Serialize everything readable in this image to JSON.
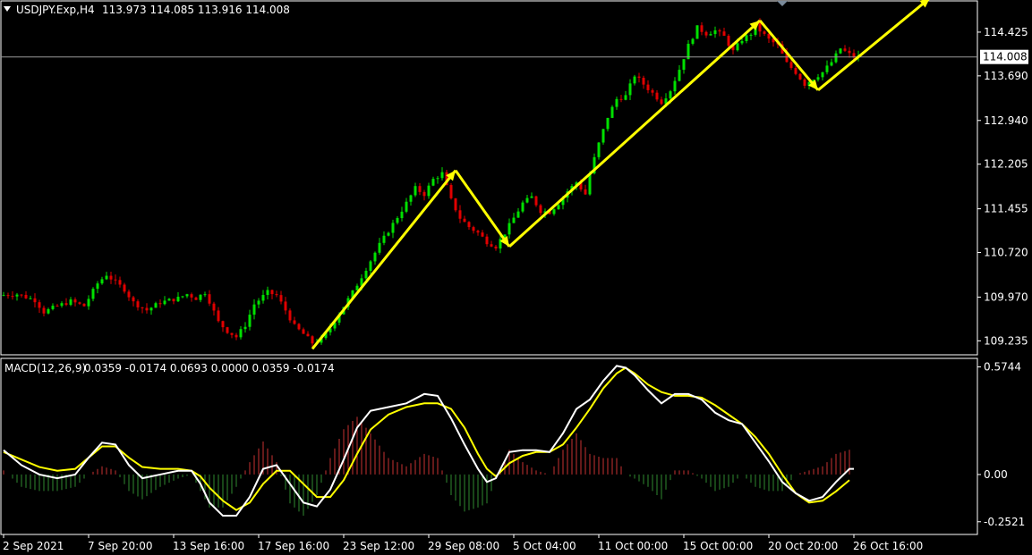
{
  "window": {
    "title": "USDJPY.Exp,H4",
    "ohlc": "113.973 114.085 113.916 114.008"
  },
  "macd": {
    "title": "MACD(12,26,9)",
    "values": "0.0359 -0.0174 0.0693 0.0000 0.0359 -0.0174"
  },
  "colors": {
    "background": "#000000",
    "bull": "#00e000",
    "bear": "#e00000",
    "arrow": "#ffff00",
    "macd_main": "#ffffff",
    "macd_signal": "#ffff00",
    "hist_pos": "#c83232",
    "hist_neg": "#2f8a2f",
    "price_line": "#9a9a9a"
  },
  "chart_data": [
    {
      "type": "candlestick",
      "symbol": "USDJPY.Exp",
      "timeframe": "H4",
      "ylim": [
        109.0,
        114.95
      ],
      "y_ticks": [
        "114.425",
        "113.690",
        "112.940",
        "112.205",
        "111.455",
        "110.720",
        "109.970",
        "109.235"
      ],
      "current_price": "114.008",
      "x_tick_labels": [
        "2 Sep 2021",
        "7 Sep 20:00",
        "13 Sep 16:00",
        "17 Sep 16:00",
        "23 Sep 12:00",
        "29 Sep 08:00",
        "5 Oct 04:00",
        "11 Oct 00:00",
        "15 Oct 00:00",
        "20 Oct 20:00",
        "26 Oct 16:00"
      ],
      "price_path": [
        [
          0,
          110.0
        ],
        [
          4,
          110.02
        ],
        [
          8,
          109.92
        ],
        [
          10,
          109.72
        ],
        [
          13,
          109.82
        ],
        [
          16,
          109.9
        ],
        [
          19,
          109.82
        ],
        [
          22,
          110.2
        ],
        [
          24,
          110.35
        ],
        [
          26,
          110.22
        ],
        [
          28,
          110.1
        ],
        [
          30,
          109.88
        ],
        [
          33,
          109.75
        ],
        [
          36,
          109.88
        ],
        [
          40,
          109.95
        ],
        [
          42,
          110.02
        ],
        [
          44,
          109.95
        ],
        [
          46,
          110.05
        ],
        [
          47,
          109.9
        ],
        [
          49,
          109.55
        ],
        [
          51,
          109.4
        ],
        [
          53,
          109.3
        ],
        [
          55,
          109.5
        ],
        [
          57,
          109.85
        ],
        [
          60,
          110.05
        ],
        [
          62,
          110.0
        ],
        [
          64,
          109.75
        ],
        [
          66,
          109.48
        ],
        [
          68,
          109.35
        ],
        [
          70,
          109.2
        ],
        [
          72,
          109.25
        ],
        [
          74,
          109.45
        ],
        [
          76,
          109.7
        ],
        [
          79,
          110.05
        ],
        [
          82,
          110.45
        ],
        [
          85,
          110.85
        ],
        [
          88,
          111.2
        ],
        [
          91,
          111.55
        ],
        [
          93,
          111.8
        ],
        [
          95,
          111.7
        ],
        [
          97,
          111.95
        ],
        [
          99,
          112.05
        ],
        [
          101,
          111.6
        ],
        [
          103,
          111.3
        ],
        [
          105,
          111.15
        ],
        [
          107,
          111.05
        ],
        [
          109,
          110.9
        ],
        [
          111,
          110.82
        ],
        [
          113,
          111.05
        ],
        [
          115,
          111.3
        ],
        [
          117,
          111.55
        ],
        [
          119,
          111.65
        ],
        [
          121,
          111.42
        ],
        [
          123,
          111.4
        ],
        [
          125,
          111.55
        ],
        [
          127,
          111.75
        ],
        [
          129,
          111.9
        ],
        [
          131,
          111.7
        ],
        [
          132,
          112.05
        ],
        [
          134,
          112.55
        ],
        [
          136,
          113.0
        ],
        [
          138,
          113.3
        ],
        [
          140,
          113.35
        ],
        [
          142,
          113.7
        ],
        [
          144,
          113.55
        ],
        [
          146,
          113.4
        ],
        [
          148,
          113.25
        ],
        [
          150,
          113.45
        ],
        [
          152,
          113.8
        ],
        [
          154,
          114.2
        ],
        [
          156,
          114.5
        ],
        [
          158,
          114.4
        ],
        [
          160,
          114.45
        ],
        [
          162,
          114.35
        ],
        [
          164,
          114.1
        ],
        [
          166,
          114.3
        ],
        [
          168,
          114.4
        ],
        [
          169,
          114.55
        ],
        [
          170,
          114.45
        ],
        [
          172,
          114.3
        ],
        [
          174,
          114.2
        ],
        [
          176,
          113.9
        ],
        [
          178,
          113.75
        ],
        [
          180,
          113.55
        ],
        [
          182,
          113.65
        ],
        [
          184,
          113.75
        ],
        [
          186,
          113.92
        ],
        [
          188,
          114.15
        ],
        [
          190,
          114.05
        ],
        [
          191,
          114.01
        ]
      ],
      "arrows": [
        {
          "from": [
            109.1
          ],
          "to": [
            112.1
          ]
        },
        {
          "from": [
            112.1
          ],
          "to": [
            110.82
          ]
        },
        {
          "from": [
            110.82
          ],
          "to": [
            114.62
          ]
        },
        {
          "from": [
            114.62
          ],
          "to": [
            113.45
          ]
        },
        {
          "from": [
            113.45
          ],
          "to": [
            115.0
          ]
        }
      ]
    },
    {
      "type": "line",
      "name": "MACD(12,26,9)",
      "ylim": [
        -0.32,
        0.62
      ],
      "y_ticks": [
        "0.5744",
        "0.00",
        "-0.2521"
      ],
      "main": [
        [
          0,
          0.13
        ],
        [
          4,
          0.05
        ],
        [
          8,
          0.0
        ],
        [
          12,
          -0.02
        ],
        [
          16,
          0.0
        ],
        [
          19,
          0.09
        ],
        [
          22,
          0.17
        ],
        [
          25,
          0.16
        ],
        [
          28,
          0.05
        ],
        [
          31,
          -0.02
        ],
        [
          35,
          0.0
        ],
        [
          39,
          0.02
        ],
        [
          42,
          0.02
        ],
        [
          44,
          -0.05
        ],
        [
          46,
          -0.15
        ],
        [
          49,
          -0.22
        ],
        [
          52,
          -0.22
        ],
        [
          55,
          -0.12
        ],
        [
          58,
          0.03
        ],
        [
          61,
          0.05
        ],
        [
          64,
          -0.05
        ],
        [
          67,
          -0.15
        ],
        [
          70,
          -0.17
        ],
        [
          73,
          -0.08
        ],
        [
          76,
          0.08
        ],
        [
          79,
          0.25
        ],
        [
          82,
          0.34
        ],
        [
          86,
          0.36
        ],
        [
          90,
          0.38
        ],
        [
          94,
          0.43
        ],
        [
          97,
          0.42
        ],
        [
          100,
          0.3
        ],
        [
          103,
          0.16
        ],
        [
          106,
          0.03
        ],
        [
          108,
          -0.04
        ],
        [
          110,
          -0.02
        ],
        [
          113,
          0.12
        ],
        [
          116,
          0.13
        ],
        [
          119,
          0.13
        ],
        [
          122,
          0.12
        ],
        [
          125,
          0.22
        ],
        [
          128,
          0.35
        ],
        [
          131,
          0.4
        ],
        [
          134,
          0.5
        ],
        [
          137,
          0.58
        ],
        [
          139,
          0.57
        ],
        [
          141,
          0.53
        ],
        [
          144,
          0.45
        ],
        [
          147,
          0.38
        ],
        [
          150,
          0.43
        ],
        [
          153,
          0.43
        ],
        [
          156,
          0.4
        ],
        [
          159,
          0.33
        ],
        [
          162,
          0.29
        ],
        [
          165,
          0.27
        ],
        [
          168,
          0.17
        ],
        [
          171,
          0.07
        ],
        [
          174,
          -0.04
        ],
        [
          177,
          -0.1
        ],
        [
          180,
          -0.14
        ],
        [
          183,
          -0.12
        ],
        [
          186,
          -0.04
        ],
        [
          189,
          0.03
        ],
        [
          190,
          0.03
        ]
      ],
      "signal": [
        [
          0,
          0.12
        ],
        [
          4,
          0.08
        ],
        [
          8,
          0.04
        ],
        [
          12,
          0.02
        ],
        [
          16,
          0.03
        ],
        [
          19,
          0.09
        ],
        [
          22,
          0.15
        ],
        [
          25,
          0.15
        ],
        [
          28,
          0.09
        ],
        [
          31,
          0.04
        ],
        [
          35,
          0.03
        ],
        [
          39,
          0.03
        ],
        [
          42,
          0.02
        ],
        [
          44,
          -0.01
        ],
        [
          46,
          -0.07
        ],
        [
          49,
          -0.14
        ],
        [
          52,
          -0.19
        ],
        [
          55,
          -0.15
        ],
        [
          58,
          -0.05
        ],
        [
          61,
          0.02
        ],
        [
          64,
          0.02
        ],
        [
          67,
          -0.05
        ],
        [
          70,
          -0.12
        ],
        [
          73,
          -0.12
        ],
        [
          76,
          -0.03
        ],
        [
          79,
          0.11
        ],
        [
          82,
          0.24
        ],
        [
          86,
          0.32
        ],
        [
          90,
          0.36
        ],
        [
          94,
          0.38
        ],
        [
          97,
          0.38
        ],
        [
          100,
          0.35
        ],
        [
          103,
          0.25
        ],
        [
          106,
          0.11
        ],
        [
          108,
          0.03
        ],
        [
          110,
          -0.01
        ],
        [
          113,
          0.06
        ],
        [
          116,
          0.1
        ],
        [
          119,
          0.12
        ],
        [
          122,
          0.12
        ],
        [
          125,
          0.16
        ],
        [
          128,
          0.25
        ],
        [
          131,
          0.35
        ],
        [
          134,
          0.46
        ],
        [
          137,
          0.54
        ],
        [
          139,
          0.57
        ],
        [
          141,
          0.54
        ],
        [
          144,
          0.48
        ],
        [
          147,
          0.44
        ],
        [
          150,
          0.42
        ],
        [
          153,
          0.42
        ],
        [
          156,
          0.41
        ],
        [
          159,
          0.37
        ],
        [
          162,
          0.32
        ],
        [
          165,
          0.27
        ],
        [
          168,
          0.2
        ],
        [
          171,
          0.11
        ],
        [
          174,
          0.0
        ],
        [
          177,
          -0.1
        ],
        [
          180,
          -0.15
        ],
        [
          183,
          -0.14
        ],
        [
          186,
          -0.09
        ],
        [
          189,
          -0.03
        ]
      ]
    }
  ]
}
